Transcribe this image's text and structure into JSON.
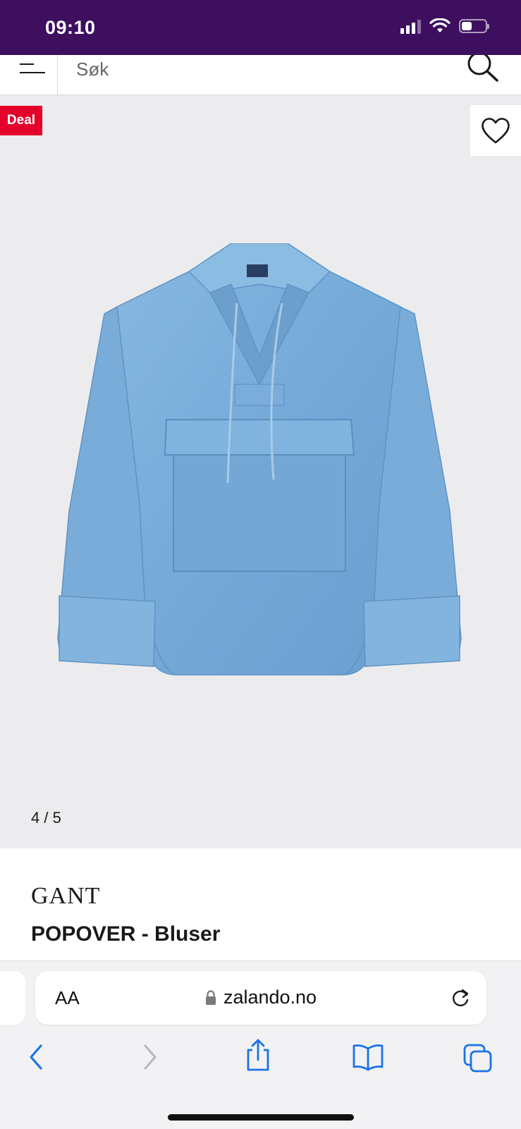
{
  "status_bar": {
    "time": "09:10",
    "battery_level": 0.45
  },
  "search": {
    "placeholder": "Søk"
  },
  "gallery": {
    "badge": "Deal",
    "image_counter": "4 / 5"
  },
  "product": {
    "brand": "GANT",
    "title": "POPOVER - Bluser"
  },
  "browser": {
    "aa_label": "AA",
    "url": "zalando.no"
  },
  "colors": {
    "status_bar": "#3e0f5f",
    "deal": "#e4002b",
    "safari_blue": "#1a73e8",
    "denim": "#7fb1dc"
  }
}
